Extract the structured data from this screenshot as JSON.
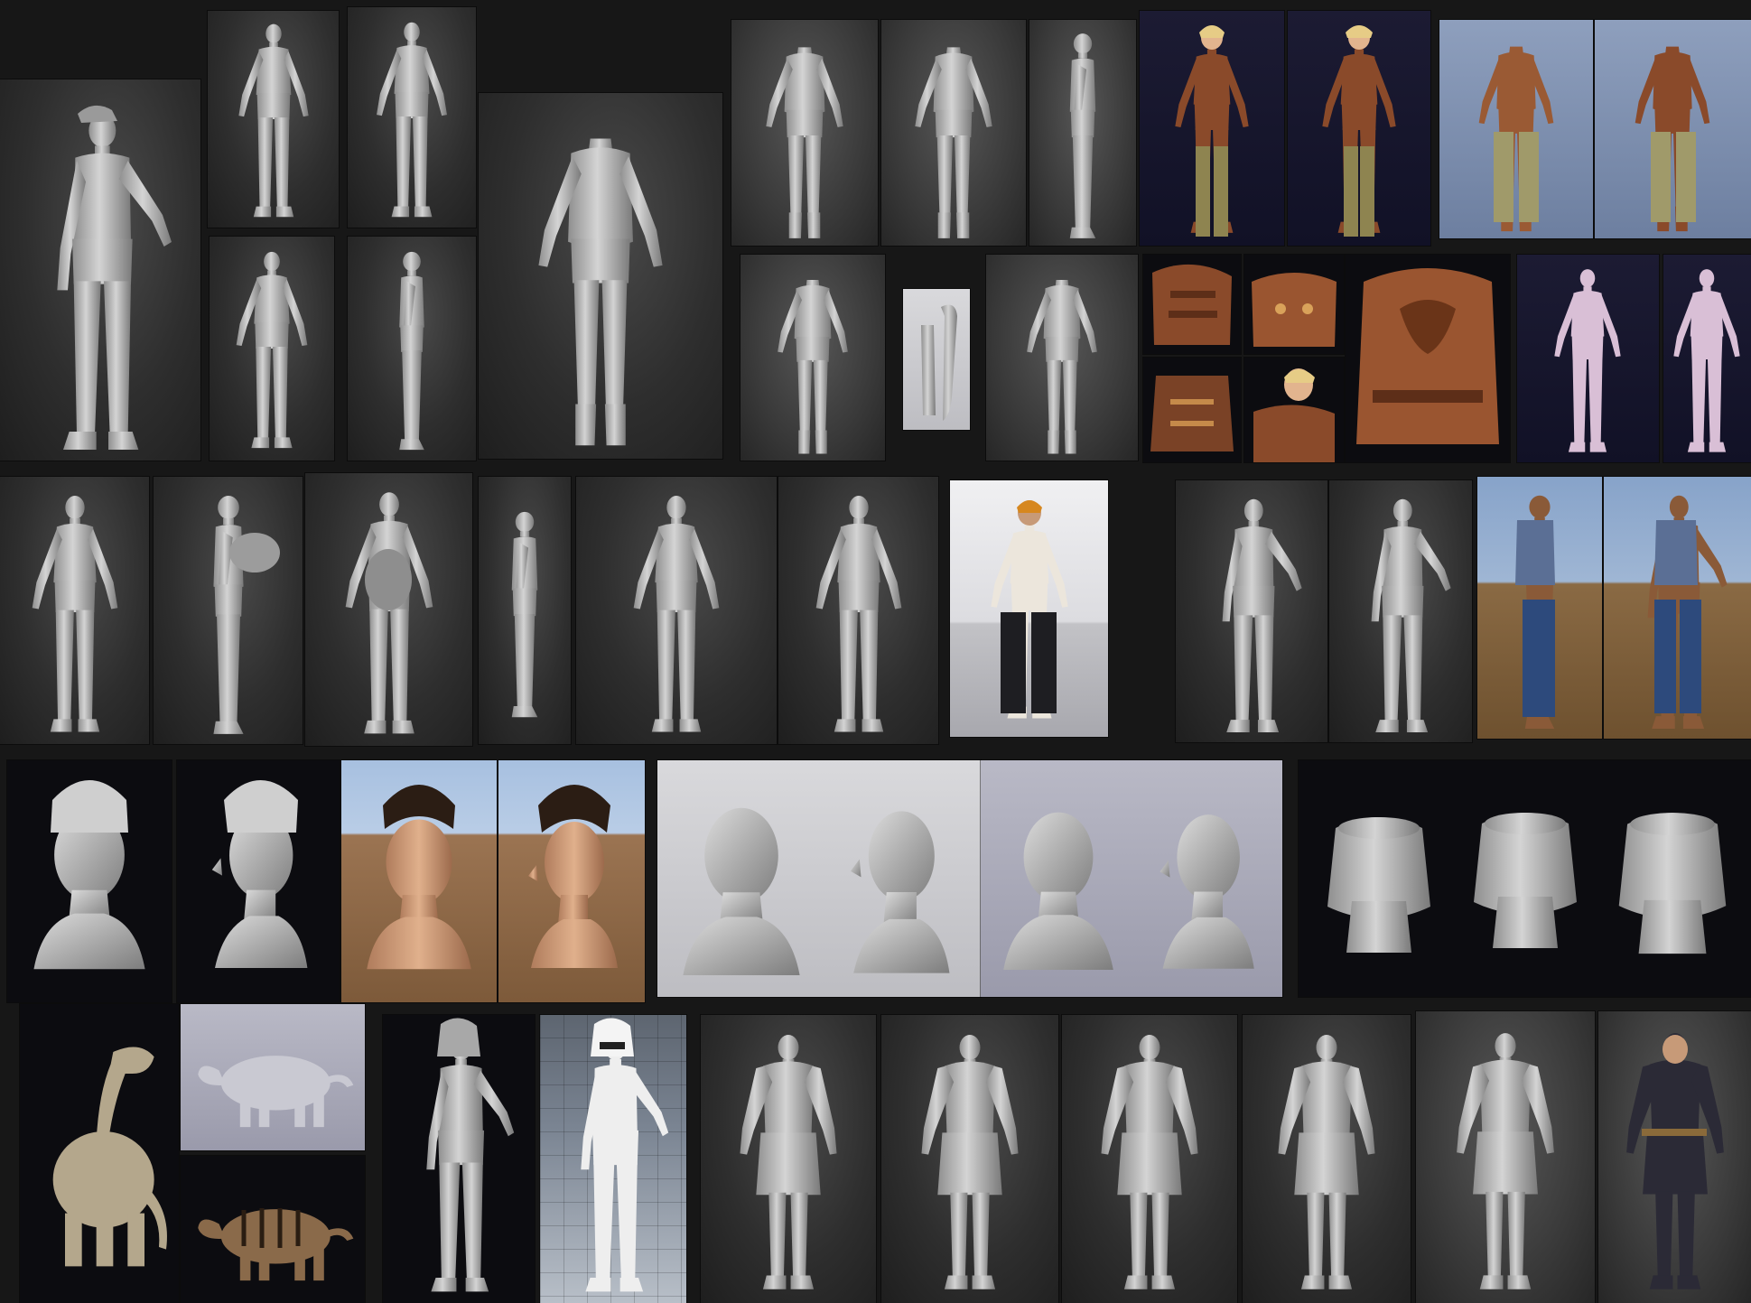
{
  "sheet": {
    "background": "#171717",
    "clay_color": "#bdbdbd",
    "accent_colors": {
      "leather": "#8a4a2a",
      "pants_khaki": "#8e8450",
      "vest_blue": "#5b6f95",
      "jeans_blue": "#2d4a7c",
      "beanie_orange": "#d6871f",
      "dark_armor": "#2b2a36"
    }
  }
}
